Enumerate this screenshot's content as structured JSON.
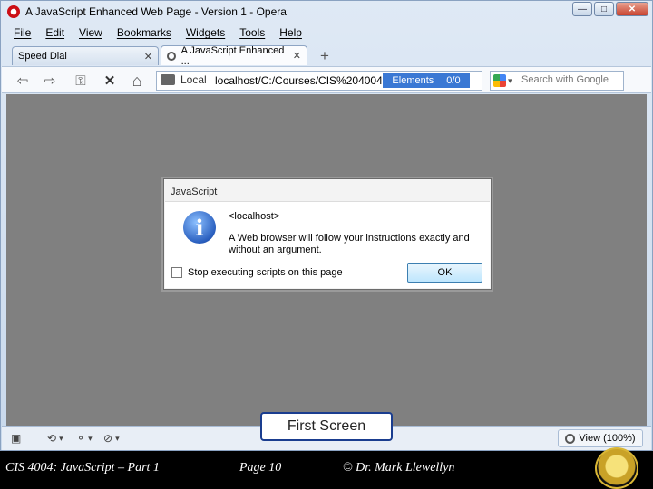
{
  "window": {
    "title": "A JavaScript Enhanced Web Page - Version 1 - Opera",
    "controls": {
      "minimize": "—",
      "maximize": "□",
      "close": "✕"
    }
  },
  "menu": [
    "File",
    "Edit",
    "View",
    "Bookmarks",
    "Widgets",
    "Tools",
    "Help"
  ],
  "tabs": [
    {
      "label": "Speed Dial",
      "close": "✕"
    },
    {
      "label": "A JavaScript Enhanced ...",
      "close": "✕"
    }
  ],
  "new_tab": "+",
  "toolbar": {
    "back_icon": "⇦",
    "forward_icon": "⇨",
    "key_icon": "⚿",
    "stop_icon": "✕",
    "home_icon": "⌂",
    "security_label": "Local",
    "url": "localhost/C:/Courses/CIS%204004%2",
    "elements_label": "Elements",
    "elements_count": "0/0",
    "search_placeholder": "Search with Google",
    "search_dropdown": "▾"
  },
  "dialog": {
    "title": "JavaScript",
    "icon": "i",
    "host": "<localhost>",
    "message": "A Web browser will follow your instructions exactly and without an argument.",
    "checkbox_label": "Stop executing scripts on this page",
    "ok_label": "OK"
  },
  "statusbar": {
    "panel_icon": "▣",
    "refresh_icon": "⟲",
    "share_icon": "⚬",
    "block_icon": "⊘",
    "dropdown": "▾",
    "view_label": "View (100%)"
  },
  "overlay_label": "First Screen",
  "footer": {
    "course": "CIS 4004: JavaScript – Part 1",
    "page": "Page 10",
    "author": "© Dr. Mark Llewellyn"
  },
  "colors": {
    "content_bg": "#808080",
    "elements_highlight": "#3a78d4",
    "opera_red": "#cc0f16"
  }
}
